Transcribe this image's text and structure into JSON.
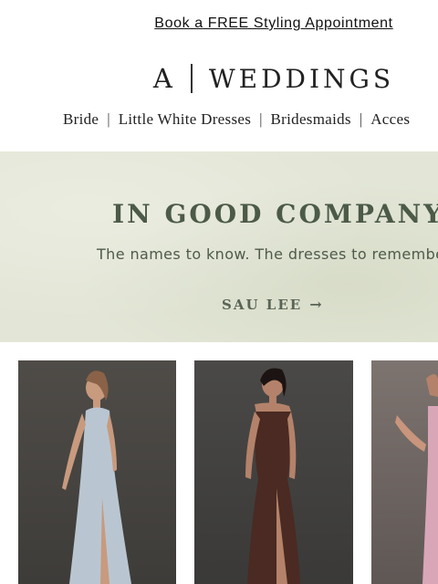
{
  "promo": {
    "label": "Book a FREE Styling Appointment"
  },
  "logo": {
    "mark": "A",
    "word": "WEDDINGS"
  },
  "nav": {
    "items": [
      "Bride",
      "Little White Dresses",
      "Bridesmaids",
      "Acces"
    ],
    "separator": "|"
  },
  "hero": {
    "title": "IN GOOD COMPANY",
    "subtitle": "The names to know. The dresses to remembe",
    "cta": "SAU LEE",
    "cta_arrow": "→",
    "background": "#e3e6d6",
    "title_color": "#4c5a48"
  },
  "products": [
    {
      "name": "product-card-light-blue-gown",
      "dress_color": "#b9c6d2"
    },
    {
      "name": "product-card-brown-lace-gown",
      "dress_color": "#4a2a22"
    },
    {
      "name": "product-card-pink-gown",
      "dress_color": "#d9a6b8"
    }
  ]
}
